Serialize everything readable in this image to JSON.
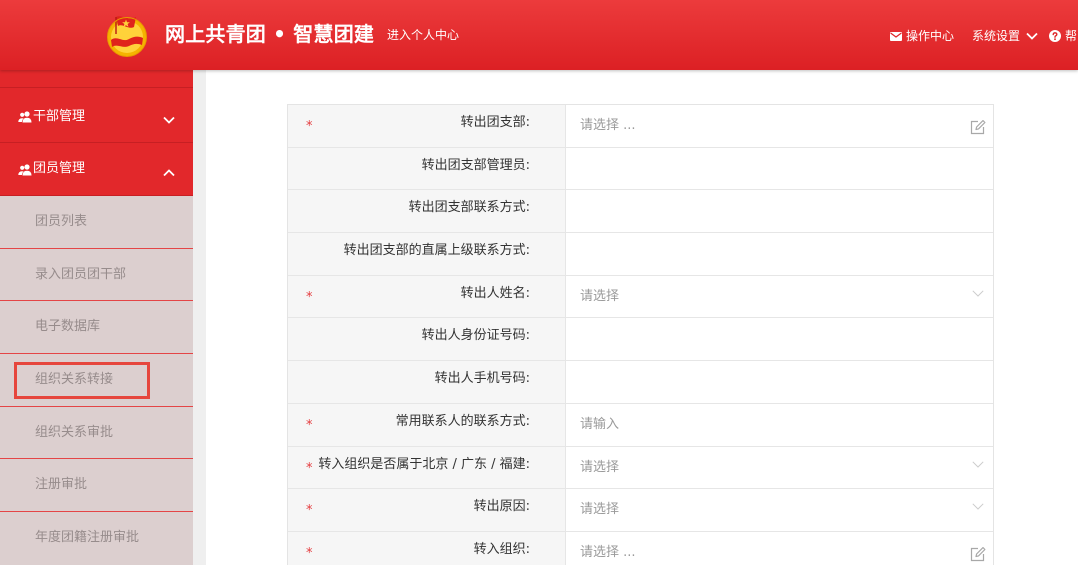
{
  "header": {
    "logo_icon": "youth-league-emblem-icon",
    "title": "网上共青团 • 智慧团建",
    "personal_center": "进入个人中心",
    "operation_center": {
      "icon": "envelope-icon",
      "label": "操作中心"
    },
    "system_settings": {
      "icon": "chevron-down-icon",
      "label": "系统设置"
    },
    "help": {
      "icon": "question-circle-icon",
      "label": "帮"
    }
  },
  "sidebar": {
    "menus": [
      {
        "icon": "users-icon",
        "label": "干部管理",
        "expanded": false,
        "chevron": "chevron-down-icon"
      },
      {
        "icon": "users-icon",
        "label": "团员管理",
        "expanded": true,
        "chevron": "chevron-up-icon"
      }
    ],
    "submenu": [
      "团员列表",
      "录入团员团干部",
      "电子数据库",
      "组织关系转接",
      "组织关系审批",
      "注册审批",
      "年度团籍注册审批"
    ],
    "highlighted_index": 3
  },
  "form": {
    "required_mark": "*",
    "rows": [
      {
        "label": "转出团支部:",
        "required": true,
        "placeholder": "请选择 ...",
        "trailing_icon": "edit-icon"
      },
      {
        "label": "转出团支部管理员:",
        "required": false,
        "placeholder": "",
        "trailing_icon": ""
      },
      {
        "label": "转出团支部联系方式:",
        "required": false,
        "placeholder": "",
        "trailing_icon": ""
      },
      {
        "label": "转出团支部的直属上级联系方式:",
        "required": false,
        "placeholder": "",
        "trailing_icon": ""
      },
      {
        "label": "转出人姓名:",
        "required": true,
        "placeholder": "请选择",
        "trailing_icon": "chevron-down-icon"
      },
      {
        "label": "转出人身份证号码:",
        "required": false,
        "placeholder": "",
        "trailing_icon": ""
      },
      {
        "label": "转出人手机号码:",
        "required": false,
        "placeholder": "",
        "trailing_icon": ""
      },
      {
        "label": "常用联系人的联系方式:",
        "required": true,
        "placeholder": "请输入",
        "trailing_icon": ""
      },
      {
        "label": "转入组织是否属于北京 / 广东 / 福建:",
        "required": true,
        "placeholder": "请选择",
        "trailing_icon": "chevron-down-icon"
      },
      {
        "label": "转出原因:",
        "required": true,
        "placeholder": "请选择",
        "trailing_icon": "chevron-down-icon"
      },
      {
        "label": "转入组织:",
        "required": true,
        "placeholder": "请选择 ...",
        "trailing_icon": "edit-icon"
      }
    ]
  },
  "colors": {
    "brand_red": "#e2282b",
    "submenu_bg": "#dccfcf",
    "highlight_border": "#e6463d",
    "required_mark": "#e4393c",
    "placeholder_text": "#9a9a9a",
    "label_bg": "#f6f6f6"
  }
}
